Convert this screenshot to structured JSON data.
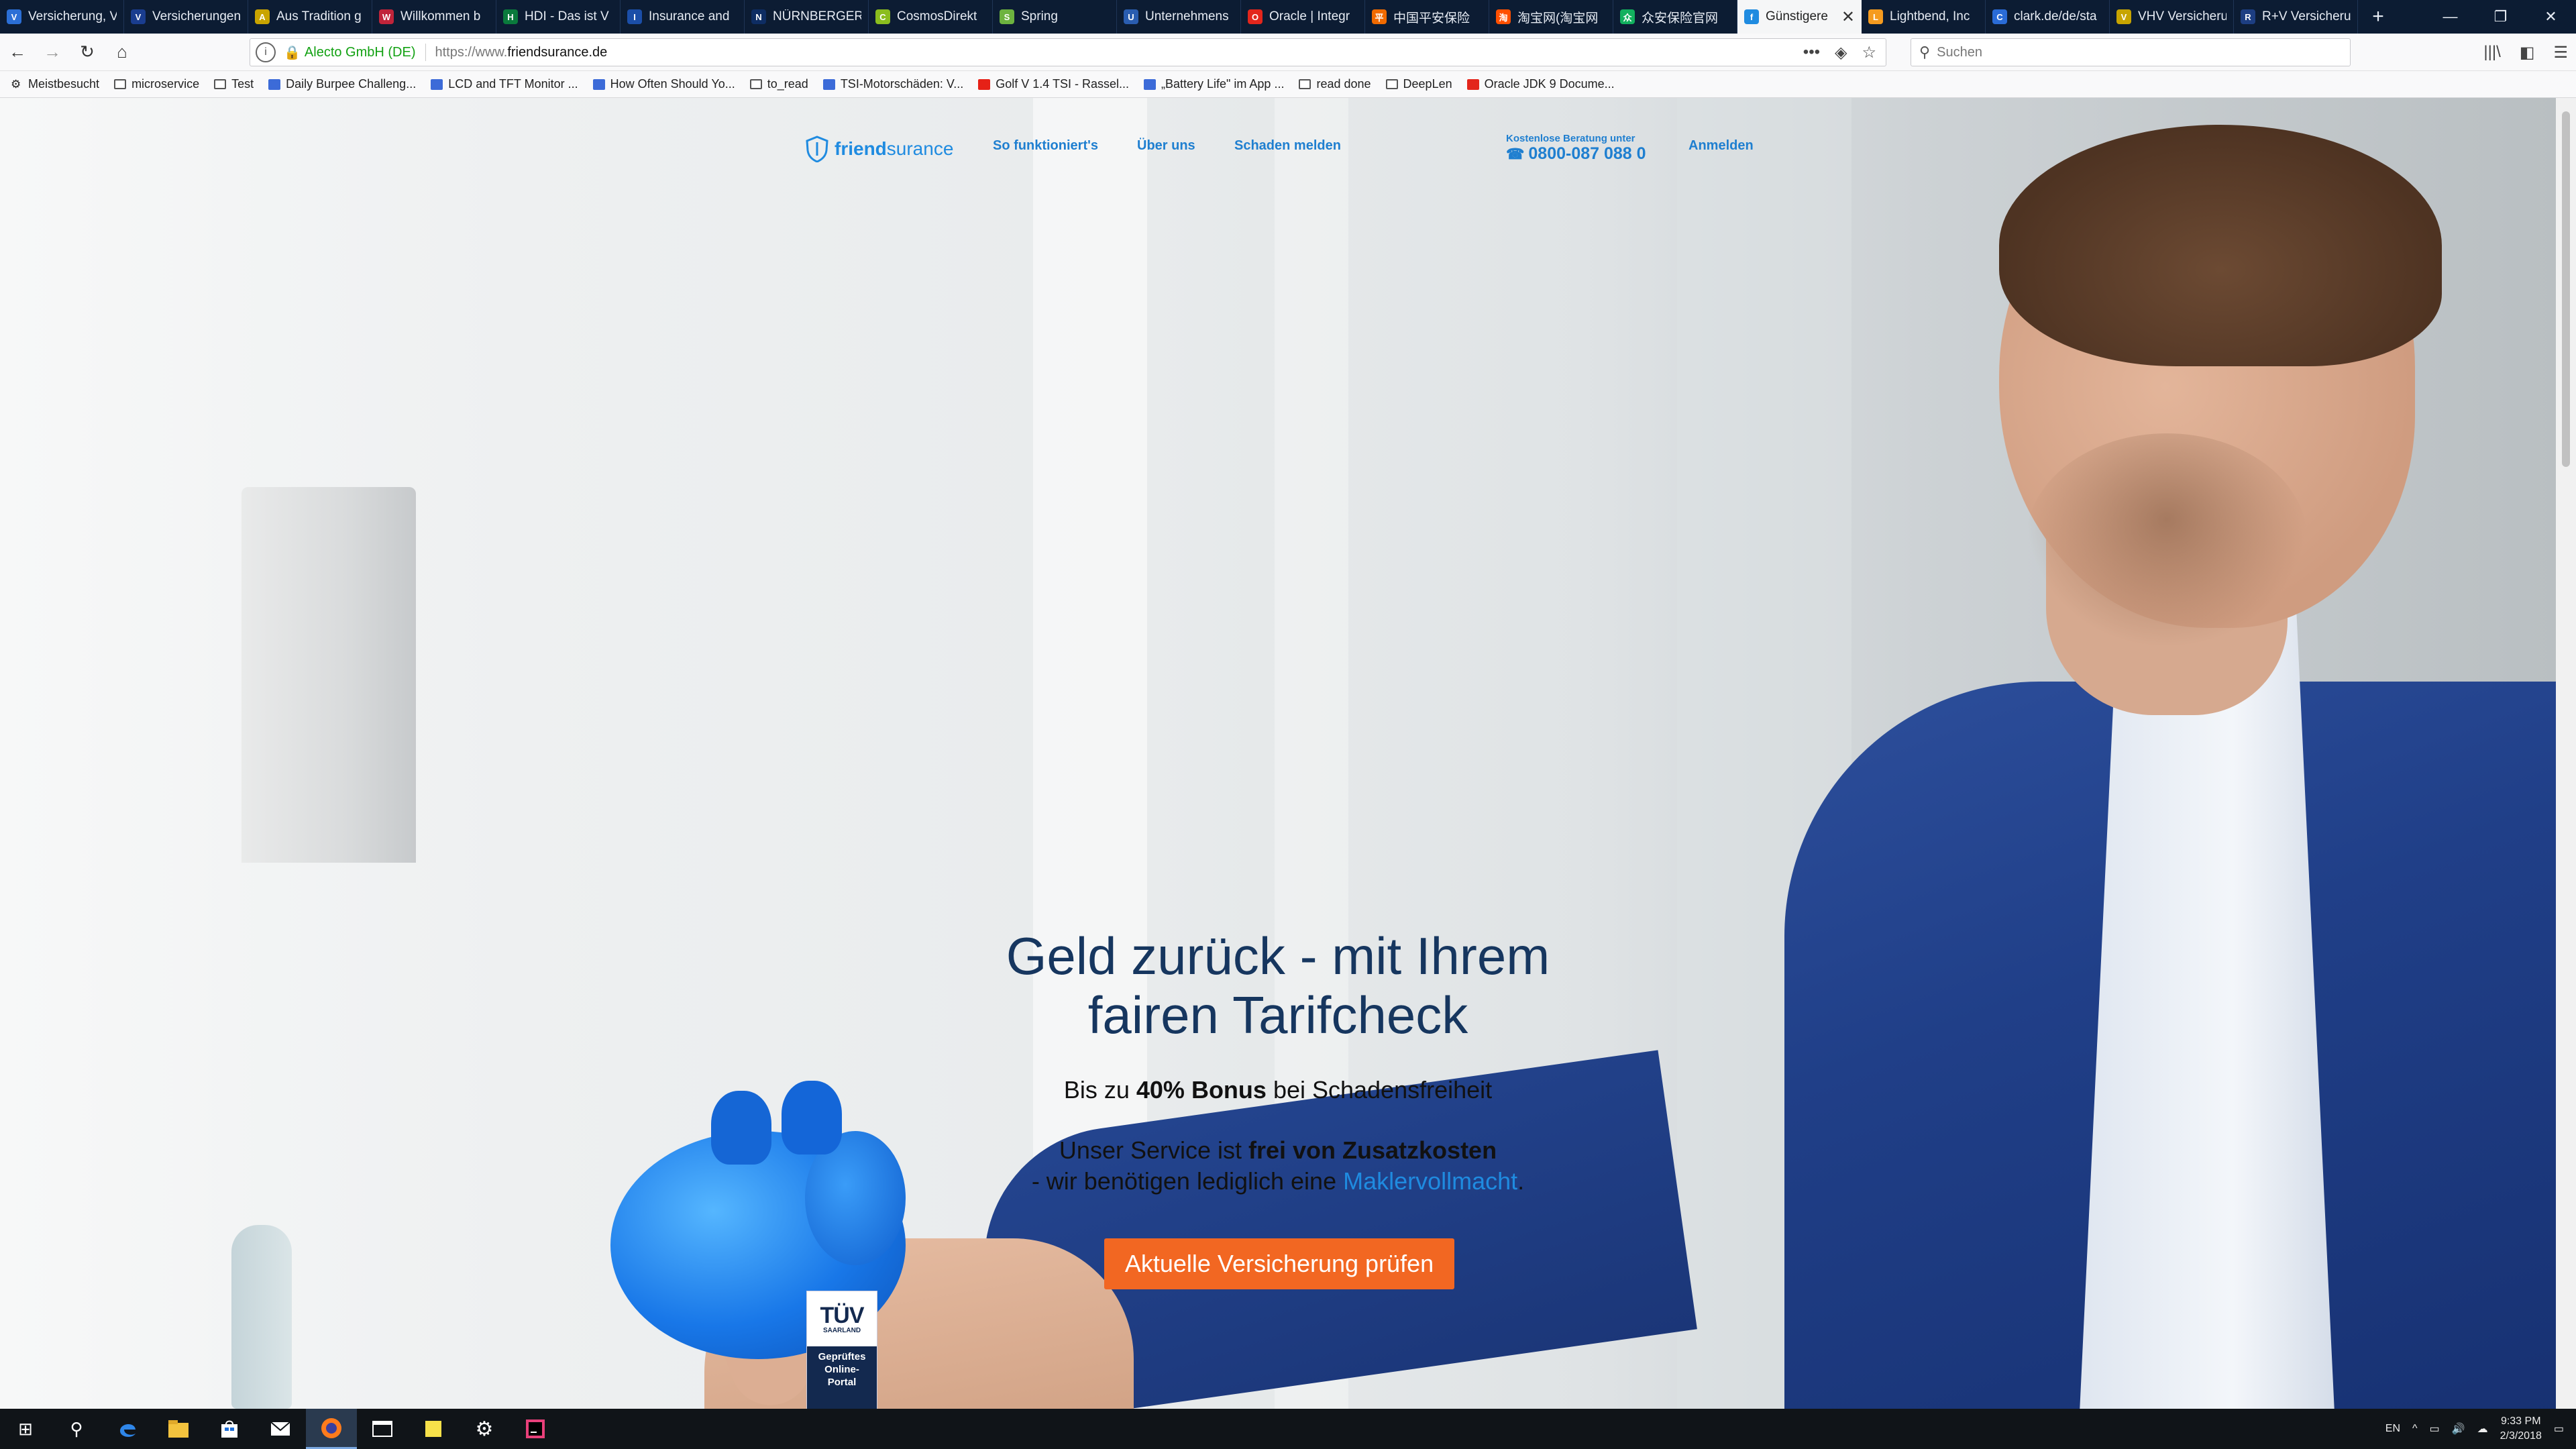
{
  "browser": {
    "tabs": [
      {
        "label": "Versicherung, V",
        "color": "#2b6fd6",
        "glyph": "V"
      },
      {
        "label": "Versicherungen",
        "color": "#1a3d8f",
        "glyph": "V"
      },
      {
        "label": "Aus Tradition g",
        "color": "#c9a400",
        "glyph": "A"
      },
      {
        "label": "Willkommen b",
        "color": "#c0243a",
        "glyph": "W"
      },
      {
        "label": "HDI - Das ist V",
        "color": "#0a7a3c",
        "glyph": "H"
      },
      {
        "label": "Insurance and",
        "color": "#1b4ea8",
        "glyph": "I"
      },
      {
        "label": "NÜRNBERGER",
        "color": "#0e2d63",
        "glyph": "N"
      },
      {
        "label": "CosmosDirekt",
        "color": "#8bbd1e",
        "glyph": "C"
      },
      {
        "label": "Spring",
        "color": "#6db33f",
        "glyph": "S"
      },
      {
        "label": "Unternehmens",
        "color": "#2a5db0",
        "glyph": "U"
      },
      {
        "label": "Oracle | Integr",
        "color": "#e3261c",
        "glyph": "O"
      },
      {
        "label": "中国平安保险",
        "color": "#f06a00",
        "glyph": "平"
      },
      {
        "label": "淘宝网(淘宝网",
        "color": "#ff5000",
        "glyph": "淘"
      },
      {
        "label": "众安保险官网",
        "color": "#12b05e",
        "glyph": "众"
      },
      {
        "label": "Günstigere",
        "color": "#1f8be0",
        "glyph": "f",
        "active": true
      },
      {
        "label": "Lightbend, Inc",
        "color": "#f59b1f",
        "glyph": "L"
      },
      {
        "label": "clark.de/de/sta",
        "color": "#2a6bd6",
        "glyph": "C"
      },
      {
        "label": "VHV Versicheru",
        "color": "#c7a400",
        "glyph": "V"
      },
      {
        "label": "R+V Versicheru",
        "color": "#1d3e82",
        "glyph": "R"
      }
    ],
    "tab_close_glyph": "✕",
    "new_tab_glyph": "+",
    "window_controls": {
      "minimize": "—",
      "restore": "❐",
      "close": "✕"
    },
    "nav": {
      "back": "←",
      "forward": "→",
      "reload": "↻",
      "home": "⌂"
    },
    "urlbar": {
      "info_glyph": "i",
      "lock_glyph": "🔒",
      "identity": "Alecto GmbH (DE)",
      "url_prefix": "https://www.",
      "url_host": "friendsurance.de",
      "page_actions": "•••",
      "pocket_glyph": "◈",
      "star_glyph": "☆"
    },
    "search": {
      "placeholder": "Suchen",
      "icon": "search-icon"
    },
    "toolbar_right": {
      "library": "|||\\",
      "sidebar": "◧",
      "menu": "☰"
    },
    "bookmarks": [
      {
        "label": "Meistbesucht",
        "icon": "gear-icon"
      },
      {
        "label": "microservice",
        "icon": "folder-icon"
      },
      {
        "label": "Test",
        "icon": "folder-icon"
      },
      {
        "label": "Daily Burpee Challeng...",
        "icon": "site-icon"
      },
      {
        "label": "LCD and TFT Monitor ...",
        "icon": "site-icon"
      },
      {
        "label": "How Often Should Yo...",
        "icon": "site-icon"
      },
      {
        "label": "to_read",
        "icon": "folder-icon"
      },
      {
        "label": "TSI-Motorschäden: V...",
        "icon": "site-icon"
      },
      {
        "label": "Golf V 1.4 TSI - Rassel...",
        "icon": "youtube-icon"
      },
      {
        "label": "„Battery Life\" im App ...",
        "icon": "site-icon"
      },
      {
        "label": "read done",
        "icon": "folder-icon"
      },
      {
        "label": "DeepLen",
        "icon": "folder-icon"
      },
      {
        "label": "Oracle JDK 9 Docume...",
        "icon": "oracle-icon"
      }
    ]
  },
  "site": {
    "logo": {
      "friend": "friend",
      "surance": "surance"
    },
    "nav": [
      "So funktioniert's",
      "Über uns",
      "Schaden melden"
    ],
    "hotline": {
      "label": "Kostenlose Beratung unter",
      "phone": "0800-087 088 0",
      "phone_icon": "☎"
    },
    "login": "Anmelden",
    "hero": {
      "title_line1": "Geld zurück - mit Ihrem",
      "title_line2": "fairen Tarifcheck",
      "bonus_pre": "Bis zu ",
      "bonus_bold": "40% Bonus",
      "bonus_post": " bei Schadensfreiheit",
      "service_pre": "Unser Service ist ",
      "service_bold": "frei von Zusatzkosten",
      "line3_pre": "- wir benötigen lediglich eine ",
      "line3_link": "Maklervollmacht",
      "line3_post": "."
    },
    "cta": "Aktuelle Versicherung prüfen",
    "tuv": {
      "brand": "TÜV",
      "region": "SAARLAND",
      "line1": "Geprüftes",
      "line2": "Online-",
      "line3": "Portal"
    }
  },
  "taskbar": {
    "start": "⊞",
    "search": "⚲",
    "apps": [
      "edge-icon",
      "explorer-icon",
      "store-icon",
      "mail-icon",
      "firefox-icon",
      "window-icon",
      "sticky-notes-icon",
      "settings-icon",
      "intellij-icon"
    ],
    "tray_lang": "EN",
    "tray_chevron": "^",
    "time": "9:33 PM",
    "date": "2/3/2018",
    "notification": "▭"
  },
  "colors": {
    "brand_blue": "#1f8be0",
    "cta_orange": "#f26722",
    "title_navy": "#16365f"
  }
}
